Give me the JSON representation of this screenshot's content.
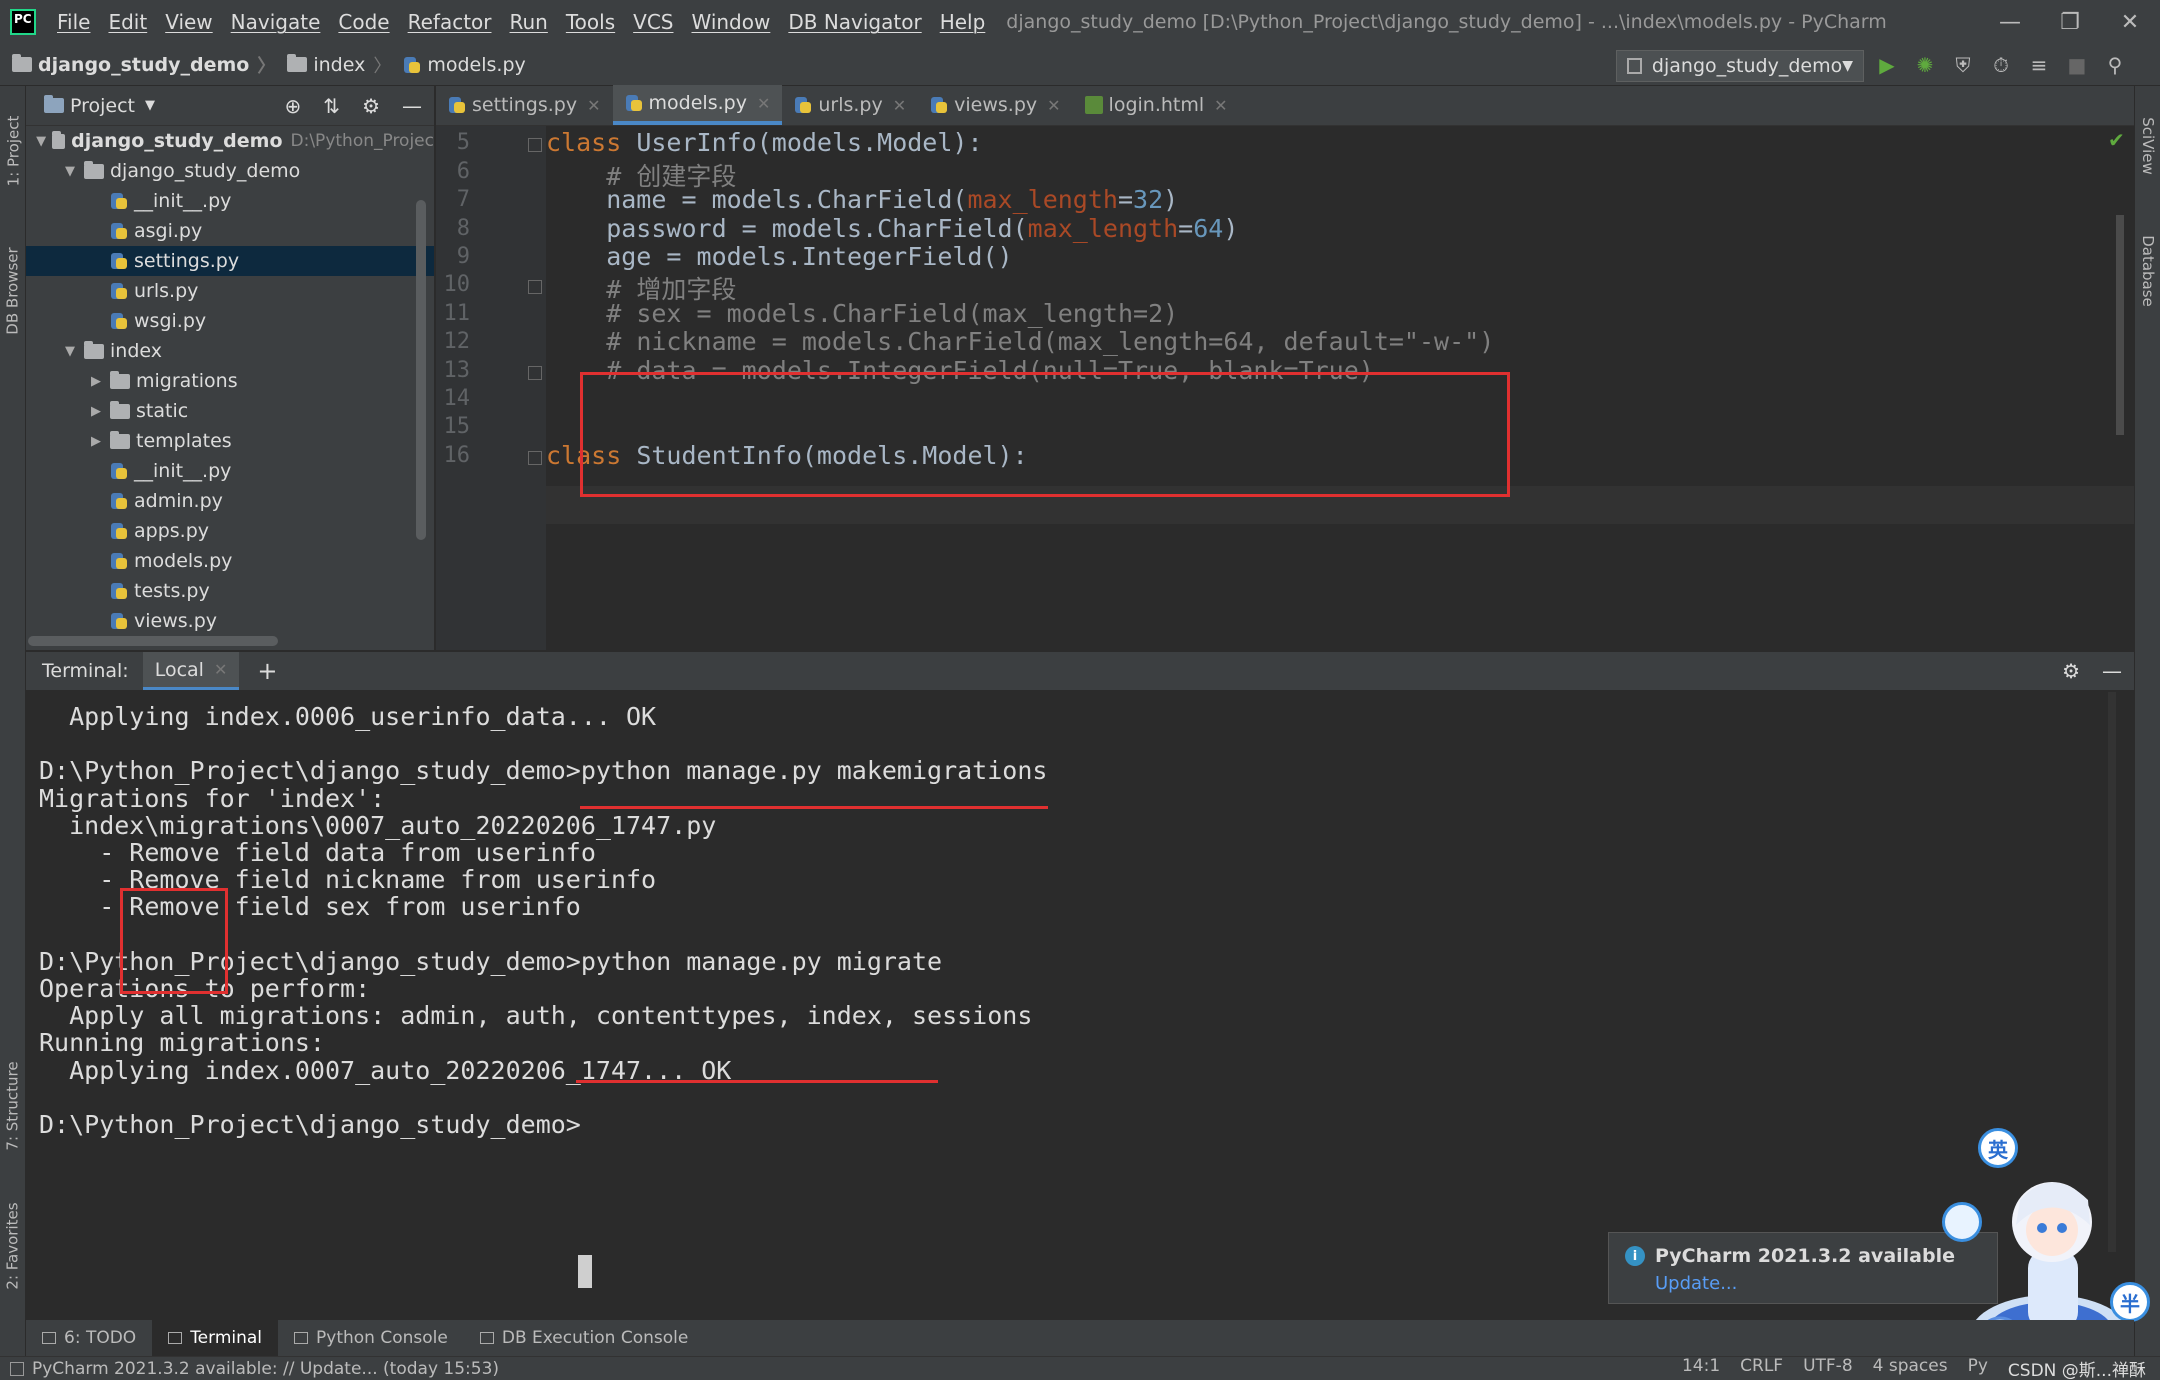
{
  "app": {
    "menu": [
      "File",
      "Edit",
      "View",
      "Navigate",
      "Code",
      "Refactor",
      "Run",
      "Tools",
      "VCS",
      "Window",
      "DB Navigator",
      "Help"
    ],
    "title": "django_study_demo [D:\\Python_Project\\django_study_demo] - ...\\index\\models.py - PyCharm"
  },
  "breadcrumb": {
    "project": "django_study_demo",
    "folder": "index",
    "file": "models.py"
  },
  "run_config": "django_study_demo",
  "project_panel": {
    "title": "Project",
    "tree": [
      {
        "label": "django_study_demo",
        "suffix": "D:\\Python_Projec",
        "level": 0,
        "kind": "folder",
        "expanded": true,
        "bold": true
      },
      {
        "label": "django_study_demo",
        "level": 1,
        "kind": "pkg",
        "expanded": true
      },
      {
        "label": "__init__.py",
        "level": 2,
        "kind": "py"
      },
      {
        "label": "asgi.py",
        "level": 2,
        "kind": "py"
      },
      {
        "label": "settings.py",
        "level": 2,
        "kind": "py",
        "selected": true
      },
      {
        "label": "urls.py",
        "level": 2,
        "kind": "py"
      },
      {
        "label": "wsgi.py",
        "level": 2,
        "kind": "py"
      },
      {
        "label": "index",
        "level": 1,
        "kind": "pkg",
        "expanded": true
      },
      {
        "label": "migrations",
        "level": 2,
        "kind": "folder",
        "collapsed": true
      },
      {
        "label": "static",
        "level": 2,
        "kind": "folder",
        "collapsed": true
      },
      {
        "label": "templates",
        "level": 2,
        "kind": "folder",
        "collapsed": true
      },
      {
        "label": "__init__.py",
        "level": 2,
        "kind": "py"
      },
      {
        "label": "admin.py",
        "level": 2,
        "kind": "py"
      },
      {
        "label": "apps.py",
        "level": 2,
        "kind": "py"
      },
      {
        "label": "models.py",
        "level": 2,
        "kind": "py"
      },
      {
        "label": "tests.py",
        "level": 2,
        "kind": "py"
      },
      {
        "label": "views.py",
        "level": 2,
        "kind": "py"
      }
    ]
  },
  "editor_tabs": [
    {
      "label": "settings.py",
      "kind": "py",
      "active": false
    },
    {
      "label": "models.py",
      "kind": "py",
      "active": true
    },
    {
      "label": "urls.py",
      "kind": "py",
      "active": false
    },
    {
      "label": "views.py",
      "kind": "py",
      "active": false
    },
    {
      "label": "login.html",
      "kind": "html",
      "active": false
    }
  ],
  "code_lines": [
    {
      "no": "5",
      "html": "<span class=\"kw\">class</span> UserInfo(models.Model):"
    },
    {
      "no": "6",
      "html": "    <span class=\"cm\"># 创建字段</span>"
    },
    {
      "no": "7",
      "html": "    name = models.CharField(<span class=\"param\">max_length</span>=<span class=\"num\">32</span>)"
    },
    {
      "no": "8",
      "html": "    password = models.CharField(<span class=\"param\">max_length</span>=<span class=\"num\">64</span>)"
    },
    {
      "no": "9",
      "html": "    age = models.IntegerField()"
    },
    {
      "no": "10",
      "html": "    <span class=\"cm\"># 增加字段</span>"
    },
    {
      "no": "11",
      "html": "    <span class=\"cm\"># sex = models.CharField(max_length=2)</span>"
    },
    {
      "no": "12",
      "html": "    <span class=\"cm\"># nickname = models.CharField(max_length=64, default=\"-w-\")</span>"
    },
    {
      "no": "13",
      "html": "    <span class=\"cm\"># data = models.IntegerField(null=True, blank=True)</span>"
    },
    {
      "no": "14",
      "html": ""
    },
    {
      "no": "15",
      "html": ""
    },
    {
      "no": "16",
      "html": "<span class=\"kw\">class</span> StudentInfo(models.Model):"
    }
  ],
  "terminal": {
    "label": "Terminal:",
    "tab": "Local",
    "lines": [
      "  Applying index.0006_userinfo_data... OK",
      "",
      "D:\\Python_Project\\django_study_demo>python manage.py makemigrations",
      "Migrations for 'index':",
      "  index\\migrations\\0007_auto_20220206_1747.py",
      "    - Remove field data from userinfo",
      "    - Remove field nickname from userinfo",
      "    - Remove field sex from userinfo",
      "",
      "D:\\Python_Project\\django_study_demo>python manage.py migrate",
      "Operations to perform:",
      "  Apply all migrations: admin, auth, contenttypes, index, sessions",
      "Running migrations:",
      "  Applying index.0007_auto_20220206_1747... OK",
      "",
      "D:\\Python_Project\\django_study_demo>"
    ]
  },
  "side_tabs": {
    "left": [
      "1: Project",
      "DB Browser",
      "7: Structure",
      "2: Favorites"
    ],
    "right": [
      "SciView",
      "Database"
    ]
  },
  "tool_windows": [
    {
      "label": "6: TODO",
      "active": false
    },
    {
      "label": "Terminal",
      "active": true
    },
    {
      "label": "Python Console",
      "active": false
    },
    {
      "label": "DB Execution Console",
      "active": false
    }
  ],
  "notification": {
    "title": "PyCharm 2021.3.2 available",
    "link": "Update..."
  },
  "status": {
    "message": "PyCharm 2021.3.2 available: // Update... (today 15:53)",
    "position": "14:1",
    "line_sep": "CRLF",
    "encoding": "UTF-8",
    "indent": "4 spaces",
    "interpreter": "Py",
    "watermark": "CSDN @斯...禅酥"
  },
  "ime_badges": {
    "english": "英",
    "half": "半"
  },
  "colors": {
    "highlight_red": "#e03030",
    "accent_blue": "#4a88c7",
    "run_green": "#5faa3e"
  }
}
